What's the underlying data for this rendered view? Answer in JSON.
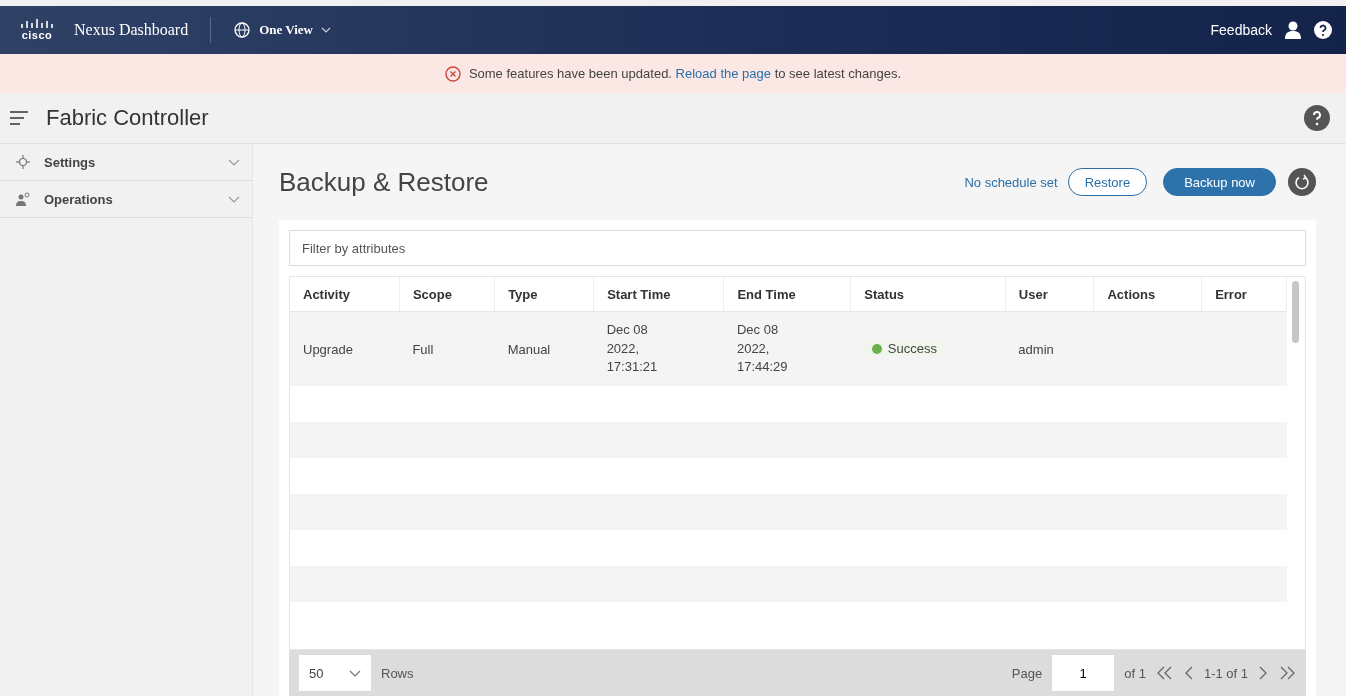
{
  "topbar": {
    "logo": "cisco",
    "brand": "Nexus Dashboard",
    "view": "One View",
    "feedback": "Feedback"
  },
  "banner": {
    "before": "Some features have been updated.",
    "link": "Reload the page",
    "after": "to see latest changes."
  },
  "header": {
    "title": "Fabric Controller"
  },
  "sidebar": {
    "items": [
      {
        "label": "Settings",
        "expanded": false
      },
      {
        "label": "Operations",
        "expanded": false
      }
    ]
  },
  "page": {
    "title": "Backup & Restore",
    "schedule": "No schedule set",
    "buttons": [
      "Restore",
      "Backup now"
    ]
  },
  "filter": {
    "placeholder": "Filter by attributes"
  },
  "table": {
    "columns": [
      "Activity",
      "Scope",
      "Type",
      "Start Time",
      "End Time",
      "Status",
      "User",
      "Actions",
      "Error"
    ],
    "rows": [
      {
        "activity": "Upgrade",
        "scope": "Full",
        "type": "Manual",
        "start": "Dec 08 2022, 17:31:21",
        "end": "Dec 08 2022, 17:44:29",
        "status": "Success",
        "color": "#6ab04c",
        "user": "admin"
      }
    ]
  },
  "footer": {
    "page_size": "50",
    "rows_label": "Rows",
    "page_label": "Page",
    "page": "1",
    "of": "of 1",
    "range": "1-1 of 1"
  }
}
